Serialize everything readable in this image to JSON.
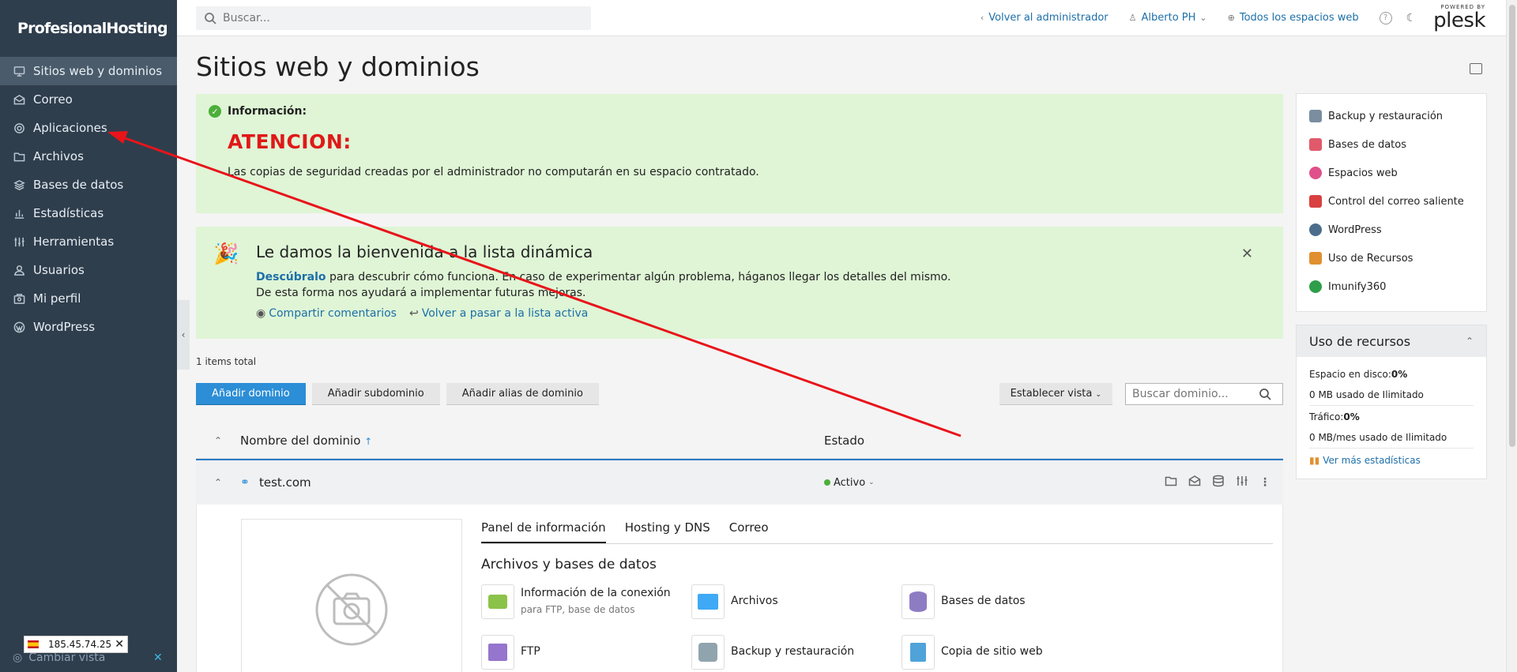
{
  "brand": {
    "logo_text": "ProfesionalHosting"
  },
  "sidebar": {
    "items": [
      {
        "label": "Sitios web y dominios",
        "icon": "monitor-icon",
        "active": true
      },
      {
        "label": "Correo",
        "icon": "mail-icon"
      },
      {
        "label": "Aplicaciones",
        "icon": "gear-icon"
      },
      {
        "label": "Archivos",
        "icon": "folder-icon"
      },
      {
        "label": "Bases de datos",
        "icon": "database-icon"
      },
      {
        "label": "Estadísticas",
        "icon": "chart-icon"
      },
      {
        "label": "Herramientas",
        "icon": "sliders-icon"
      },
      {
        "label": "Usuarios",
        "icon": "user-icon"
      },
      {
        "label": "Mi perfil",
        "icon": "profile-icon"
      },
      {
        "label": "WordPress",
        "icon": "wordpress-icon"
      }
    ],
    "cambiar_vista": "Cambiar vista",
    "ip": "185.45.74.25"
  },
  "topbar": {
    "search_placeholder": "Buscar...",
    "back_admin": "Volver al administrador",
    "user": "Alberto PH",
    "all_spaces": "Todos los espacios web",
    "powered_by": "POWERED BY",
    "plesk": "plesk"
  },
  "main": {
    "title": "Sitios web y dominios",
    "info": {
      "header": "Información:",
      "alert": "ATENCION:",
      "message": "Las copias de seguridad creadas por el administrador no computarán en su espacio contratado."
    },
    "welcome": {
      "title": "Le damos la bienvenida a la lista dinámica",
      "link": "Descúbralo",
      "desc": " para descubrir cómo funciona. En caso de experimentar algún problema, háganos llegar los detalles del mismo. De esta forma nos ayudará a implementar futuras mejoras.",
      "share": "Compartir comentarios",
      "back": "Volver a pasar a la lista activa"
    },
    "items_total": "1 items total",
    "buttons": {
      "add_domain": "Añadir dominio",
      "add_subdomain": "Añadir subdominio",
      "add_alias": "Añadir alias de dominio",
      "set_view": "Establecer vista"
    },
    "domain_search_placeholder": "Buscar dominio...",
    "table": {
      "col_name": "Nombre del dominio",
      "col_status": "Estado"
    },
    "domain": {
      "name": "test.com",
      "status": "Activo",
      "tabs": [
        "Panel de información",
        "Hosting y DNS",
        "Correo"
      ],
      "section": "Archivos y bases de datos",
      "tiles": [
        {
          "title": "Información de la conexión",
          "sub": "para FTP, base de datos",
          "icon": "connection-icon"
        },
        {
          "title": "Archivos",
          "sub": "",
          "icon": "folder-icon"
        },
        {
          "title": "Bases de datos",
          "sub": "",
          "icon": "database-icon"
        },
        {
          "title": "FTP",
          "sub": "",
          "icon": "ftp-icon"
        },
        {
          "title": "Backup y restauración",
          "sub": "",
          "icon": "backup-icon"
        },
        {
          "title": "Copia de sitio web",
          "sub": "",
          "icon": "copy-icon"
        }
      ]
    }
  },
  "right": {
    "links": [
      {
        "label": "Backup y restauración",
        "color": "#7a8ea0"
      },
      {
        "label": "Bases de datos",
        "color": "#e05a6a"
      },
      {
        "label": "Espacios web",
        "color": "#e0508a"
      },
      {
        "label": "Control del correo saliente",
        "color": "#d94040"
      },
      {
        "label": "WordPress",
        "color": "#4a6d8c"
      },
      {
        "label": "Uso de Recursos",
        "color": "#e09030"
      },
      {
        "label": "Imunify360",
        "color": "#2e9e4a"
      }
    ],
    "resources": {
      "title": "Uso de recursos",
      "disk_label": "Espacio en disco: ",
      "disk_value": "0%",
      "disk_usage": "0 MB usado de Ilimitado",
      "traffic_label": "Tráfico: ",
      "traffic_value": "0%",
      "traffic_usage": "0 MB/mes usado de Ilimitado",
      "more": "Ver más estadísticas"
    }
  },
  "colors": {
    "sidebar_bg": "#2f3e4d",
    "accent": "#2c8ed6",
    "alert_red": "#e01818",
    "info_bg": "#dff5d6"
  }
}
